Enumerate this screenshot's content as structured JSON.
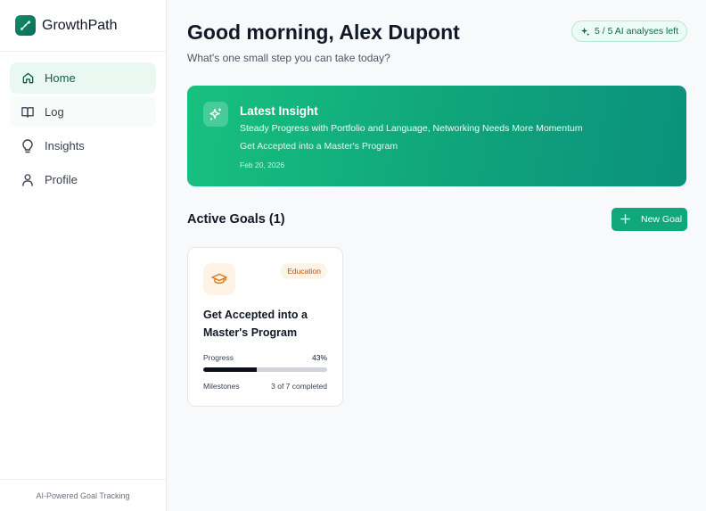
{
  "app": {
    "name": "GrowthPath",
    "logo_icon": "sparkle-path-icon",
    "brand_color": "#0f8f6a"
  },
  "sidebar": {
    "items": [
      {
        "label": "Home",
        "icon": "home-icon",
        "active": true
      },
      {
        "label": "Log",
        "icon": "book-open-icon",
        "active": false
      },
      {
        "label": "Insights",
        "icon": "lightbulb-icon",
        "active": false
      },
      {
        "label": "Profile",
        "icon": "user-icon",
        "active": false
      }
    ],
    "footer": "AI-Powered Goal Tracking"
  },
  "header": {
    "greeting": "Good morning, Alex Dupont",
    "subtitle": "What's one small step you can take today?",
    "ai_badge": "5 / 5 AI analyses left",
    "ai_badge_icon": "sparkles-icon"
  },
  "insight": {
    "title": "Latest Insight",
    "headline": "Steady Progress with Portfolio and Language, Networking Needs More Momentum",
    "goal": "Get Accepted into a Master's Program",
    "date": "Feb 20, 2026",
    "icon": "sparkles-icon",
    "gradient_start": "#18c07f",
    "gradient_end": "#0b917c"
  },
  "goals_section": {
    "title": "Active Goals (1)",
    "new_goal_label": "New Goal",
    "new_goal_icon": "plus-icon"
  },
  "goals": [
    {
      "title": "Get Accepted into a Master's Program",
      "category": "Education",
      "icon": "graduation-cap-icon",
      "progress_label": "Progress",
      "progress_text": "43%",
      "progress_fraction": 0.43,
      "milestones_label": "Milestones",
      "milestones_text": "3 of 7 completed"
    }
  ],
  "colors": {
    "accent": "#10a77a",
    "active_nav_bg": "#e9f8f1",
    "category_education": "#b4571a"
  }
}
